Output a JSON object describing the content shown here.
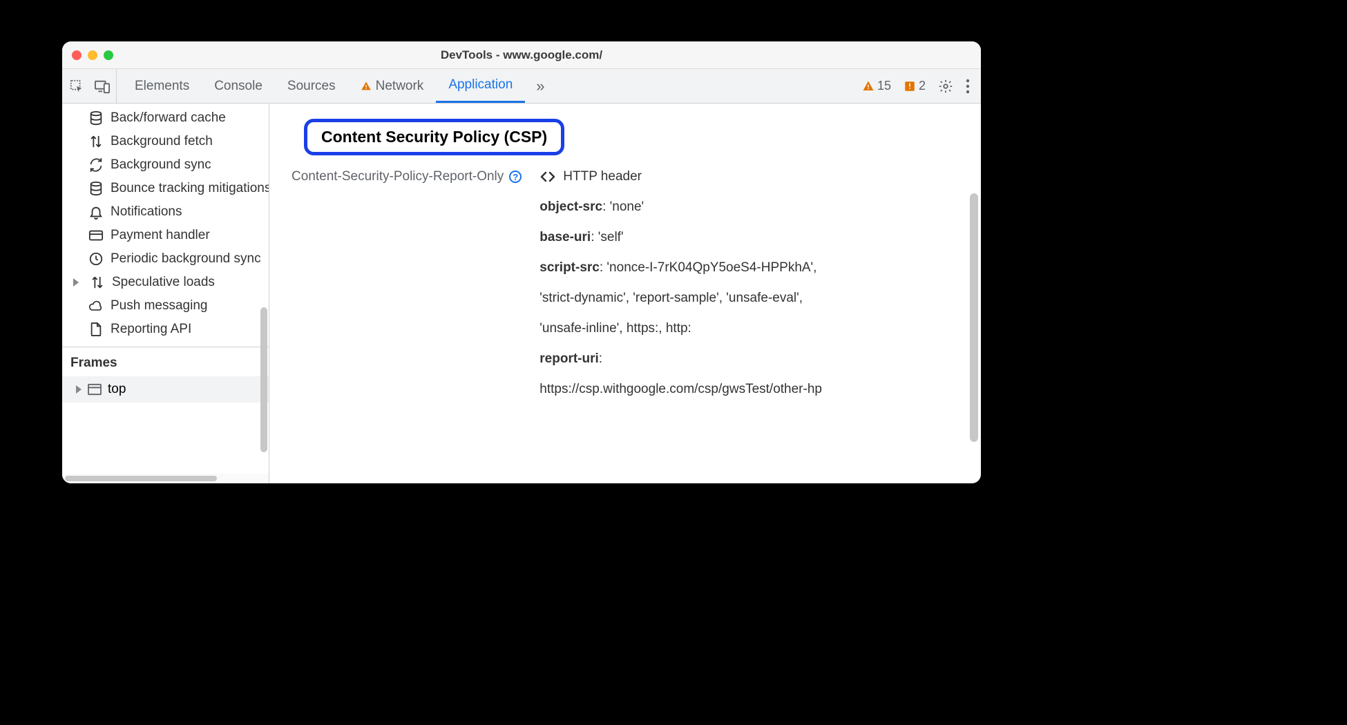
{
  "window": {
    "title": "DevTools - www.google.com/"
  },
  "toolbar": {
    "tabs": [
      {
        "label": "Elements",
        "active": false,
        "warn": false
      },
      {
        "label": "Console",
        "active": false,
        "warn": false
      },
      {
        "label": "Sources",
        "active": false,
        "warn": false
      },
      {
        "label": "Network",
        "active": false,
        "warn": true
      },
      {
        "label": "Application",
        "active": true,
        "warn": false
      }
    ],
    "warnings_count": "15",
    "issues_count": "2"
  },
  "sidebar": {
    "items": [
      {
        "icon": "database",
        "label": "Back/forward cache",
        "disclosure": false
      },
      {
        "icon": "updown",
        "label": "Background fetch",
        "disclosure": false
      },
      {
        "icon": "sync",
        "label": "Background sync",
        "disclosure": false
      },
      {
        "icon": "database",
        "label": "Bounce tracking mitigations",
        "disclosure": false
      },
      {
        "icon": "bell",
        "label": "Notifications",
        "disclosure": false
      },
      {
        "icon": "card",
        "label": "Payment handler",
        "disclosure": false
      },
      {
        "icon": "clock",
        "label": "Periodic background sync",
        "disclosure": false
      },
      {
        "icon": "updown",
        "label": "Speculative loads",
        "disclosure": true
      },
      {
        "icon": "cloud",
        "label": "Push messaging",
        "disclosure": false
      },
      {
        "icon": "file",
        "label": "Reporting API",
        "disclosure": false
      }
    ],
    "frames_header": "Frames",
    "frame_item": "top"
  },
  "main": {
    "heading": "Content Security Policy (CSP)",
    "policy_label": "Content-Security-Policy-Report-Only",
    "source_label": "HTTP header",
    "directives": [
      {
        "key": "object-src",
        "value": ": 'none'"
      },
      {
        "key": "base-uri",
        "value": ": 'self'"
      },
      {
        "key": "script-src",
        "value": ": 'nonce-I-7rK04QpY5oeS4-HPPkhA',"
      },
      {
        "key": "",
        "value": "'strict-dynamic', 'report-sample', 'unsafe-eval',"
      },
      {
        "key": "",
        "value": "'unsafe-inline', https:, http:"
      },
      {
        "key": "report-uri",
        "value": ":"
      },
      {
        "key": "",
        "value": "https://csp.withgoogle.com/csp/gwsTest/other-hp"
      }
    ]
  }
}
